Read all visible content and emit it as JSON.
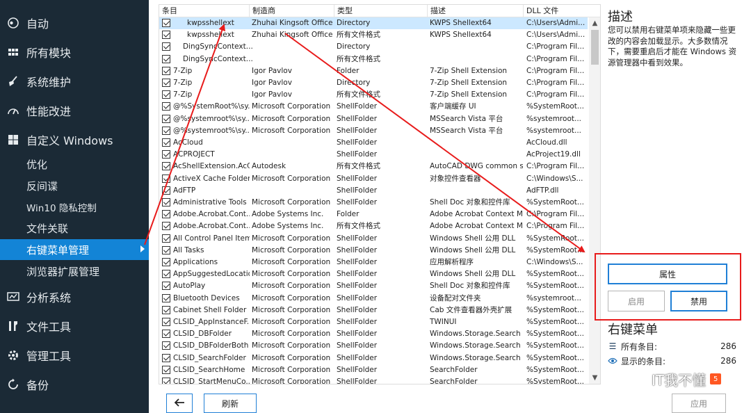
{
  "sidebar": {
    "items": [
      {
        "label": "自动",
        "icon": "toggle-icon"
      },
      {
        "label": "所有模块",
        "icon": "grid-icon"
      },
      {
        "label": "系统维护",
        "icon": "broom-icon"
      },
      {
        "label": "性能改进",
        "icon": "gauge-icon"
      },
      {
        "label": "自定义 Windows",
        "icon": "windows-icon"
      }
    ],
    "sub_items": [
      {
        "label": "优化"
      },
      {
        "label": "反间谍"
      },
      {
        "label": "Win10 隐私控制"
      },
      {
        "label": "文件关联"
      },
      {
        "label": "右键菜单管理",
        "active": true
      },
      {
        "label": "浏览器扩展管理"
      }
    ],
    "bottom_items": [
      {
        "label": "分析系统",
        "icon": "analysis-icon"
      },
      {
        "label": "文件工具",
        "icon": "file-tools-icon"
      },
      {
        "label": "管理工具",
        "icon": "gear-icon"
      },
      {
        "label": "备份",
        "icon": "backup-icon"
      }
    ]
  },
  "table": {
    "columns": [
      "条目",
      "制造商",
      "类型",
      "描述",
      "DLL 文件"
    ],
    "rows": [
      [
        "kwpsshellext",
        "Zhuhai Kingsoft Office ...",
        "Directory",
        "KWPS Shellext64",
        "C:\\Users\\Admi..."
      ],
      [
        "kwpsshellext",
        "Zhuhai Kingsoft Office ...",
        "所有文件格式",
        "KWPS Shellext64",
        "C:\\Users\\Admi..."
      ],
      [
        "DingSyncContext...",
        "",
        "Directory",
        "",
        "C:\\Program Fil..."
      ],
      [
        "DingSyncContext...",
        "",
        "所有文件格式",
        "",
        "C:\\Program Fil..."
      ],
      [
        "7-Zip",
        "Igor Pavlov",
        "Folder",
        "7-Zip Shell Extension",
        "C:\\Program Fil..."
      ],
      [
        "7-Zip",
        "Igor Pavlov",
        "Directory",
        "7-Zip Shell Extension",
        "C:\\Program Fil..."
      ],
      [
        "7-Zip",
        "Igor Pavlov",
        "所有文件格式",
        "7-Zip Shell Extension",
        "C:\\Program Fil..."
      ],
      [
        "@%SystemRoot%\\sy...",
        "Microsoft Corporation",
        "ShellFolder",
        "客户端缓存 UI",
        "%SystemRoot..."
      ],
      [
        "@%systemroot%\\sy...",
        "Microsoft Corporation",
        "ShellFolder",
        "MSSearch Vista 平台",
        "%systemroot..."
      ],
      [
        "@%systemroot%\\sy...",
        "Microsoft Corporation",
        "ShellFolder",
        "MSSearch Vista 平台",
        "%systemroot..."
      ],
      [
        "AcCloud",
        "",
        "ShellFolder",
        "",
        "AcCloud.dll"
      ],
      [
        "ACPROJECT",
        "",
        "ShellFolder",
        "",
        "AcProject19.dll"
      ],
      [
        "AcShellExtension.AcC...",
        "Autodesk",
        "所有文件格式",
        "AutoCAD DWG common sh...",
        "C:\\Program Fil..."
      ],
      [
        "ActiveX Cache Folder",
        "Microsoft Corporation",
        "ShellFolder",
        "对象控件查看器",
        "C:\\Windows\\S..."
      ],
      [
        "AdFTP",
        "",
        "ShellFolder",
        "",
        "AdFTP.dll"
      ],
      [
        "Administrative Tools",
        "Microsoft Corporation",
        "ShellFolder",
        "Shell Doc 对象和控件库",
        "%SystemRoot..."
      ],
      [
        "Adobe.Acrobat.Cont...",
        "Adobe Systems Inc.",
        "Folder",
        "Adobe Acrobat Context M...",
        "C:\\Program Fil..."
      ],
      [
        "Adobe.Acrobat.Cont...",
        "Adobe Systems Inc.",
        "所有文件格式",
        "Adobe Acrobat Context M...",
        "C:\\Program Fil..."
      ],
      [
        "All Control Panel Items",
        "Microsoft Corporation",
        "ShellFolder",
        "Windows Shell 公用 DLL",
        "%SystemRoot..."
      ],
      [
        "All Tasks",
        "Microsoft Corporation",
        "ShellFolder",
        "Windows Shell 公用 DLL",
        "%SystemRoot..."
      ],
      [
        "Applications",
        "Microsoft Corporation",
        "ShellFolder",
        "应用解析程序",
        "C:\\Windows\\S..."
      ],
      [
        "AppSuggestedLocations",
        "Microsoft Corporation",
        "ShellFolder",
        "Windows Shell 公用 DLL",
        "%SystemRoot..."
      ],
      [
        "AutoPlay",
        "Microsoft Corporation",
        "ShellFolder",
        "Shell Doc 对象和控件库",
        "%SystemRoot..."
      ],
      [
        "Bluetooth Devices",
        "Microsoft Corporation",
        "ShellFolder",
        "设备配对文件夹",
        "%systemroot..."
      ],
      [
        "Cabinet Shell Folder",
        "Microsoft Corporation",
        "ShellFolder",
        "Cab 文件查看器外壳扩展",
        "%SystemRoot..."
      ],
      [
        "CLSID_AppInstanceF...",
        "Microsoft Corporation",
        "ShellFolder",
        "TWINUI",
        "%SystemRoot..."
      ],
      [
        "CLSID_DBFolder",
        "Microsoft Corporation",
        "ShellFolder",
        "Windows.Storage.Search",
        "%SystemRoot..."
      ],
      [
        "CLSID_DBFolderBoth",
        "Microsoft Corporation",
        "ShellFolder",
        "Windows.Storage.Search",
        "%SystemRoot..."
      ],
      [
        "CLSID_SearchFolder",
        "Microsoft Corporation",
        "ShellFolder",
        "Windows.Storage.Search",
        "%SystemRoot..."
      ],
      [
        "CLSID_SearchHome",
        "Microsoft Corporation",
        "ShellFolder",
        "SearchFolder",
        "%SystemRoot..."
      ],
      [
        "CLSID_StartMenuCo...",
        "Microsoft Corporation",
        "ShellFolder",
        "SearchFolder",
        "%SystemRoot..."
      ]
    ]
  },
  "bottom": {
    "back_icon": "arrow-left-icon",
    "refresh_label": "刷新",
    "apply_label": "应用"
  },
  "right_panel": {
    "title": "描述",
    "text": "您可以禁用右键菜单项来隐藏一些更改的内容会加载显示。大多数情况下，需要重启后才能在 Windows 资源管理器中看到效果。",
    "properties_label": "属性",
    "enable_label": "启用",
    "disable_label": "禁用",
    "context_title": "右键菜单",
    "stats": [
      {
        "label": "所有条目:",
        "value": "286",
        "icon": "list-icon"
      },
      {
        "label": "显示的条目:",
        "value": "286",
        "icon": "eye-icon"
      }
    ]
  },
  "watermark": {
    "text": "IT我不懂",
    "icon": "wechat-icon"
  },
  "colors": {
    "sidebar_bg": "#1b2a36",
    "active_item": "#1384d6",
    "selected_row": "#cce8ff",
    "button_border": "#1f7fd6",
    "annotation_red": "#e81b1b"
  }
}
